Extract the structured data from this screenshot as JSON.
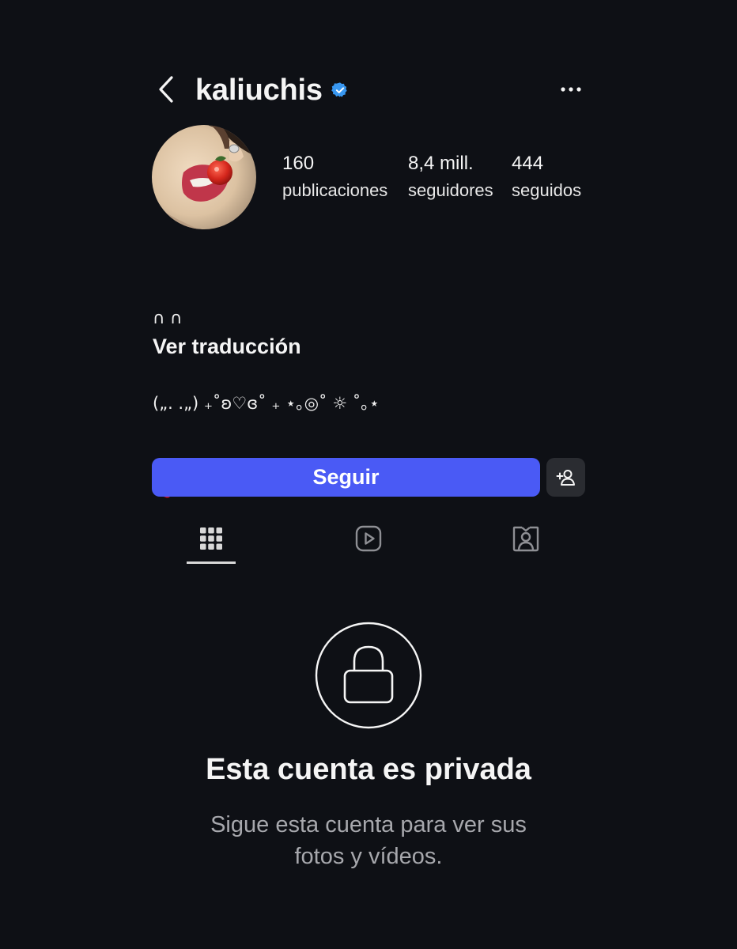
{
  "colors": {
    "background": "#0e1015",
    "accent": "#4a5af5",
    "verified": "#3897f0",
    "muted_text": "#a7a8ad"
  },
  "header": {
    "back_icon": "chevron-left-icon",
    "username": "kaliuchis",
    "verified_icon": "verified-badge-icon",
    "more_icon": "more-horizontal-icon"
  },
  "profile": {
    "avatar_icon": "avatar",
    "stats": {
      "posts": {
        "value": "160",
        "label": "publicaciones"
      },
      "followers": {
        "value": "8,4 mill.",
        "label": "seguidores"
      },
      "following": {
        "value": "444",
        "label": "seguidos"
      }
    },
    "bio": {
      "line1": "∩ ∩",
      "line2": "(„. .„) ₊˚ʚ♡ɞ˚ ₊ ⋆｡◎˚ ☼ ˚｡⋆",
      "line3": "🍓 ⊂ )"
    },
    "translate_link": "Ver traducción"
  },
  "actions": {
    "follow_label": "Seguir",
    "suggest_icon": "add-person-icon"
  },
  "tabs": [
    {
      "icon": "grid-icon",
      "active": true
    },
    {
      "icon": "reels-icon",
      "active": false
    },
    {
      "icon": "tagged-icon",
      "active": false
    }
  ],
  "private": {
    "lock_icon": "lock-icon",
    "title": "Esta cuenta es privada",
    "subtitle_line1": "Sigue esta cuenta para ver sus",
    "subtitle_line2": "fotos y vídeos."
  }
}
